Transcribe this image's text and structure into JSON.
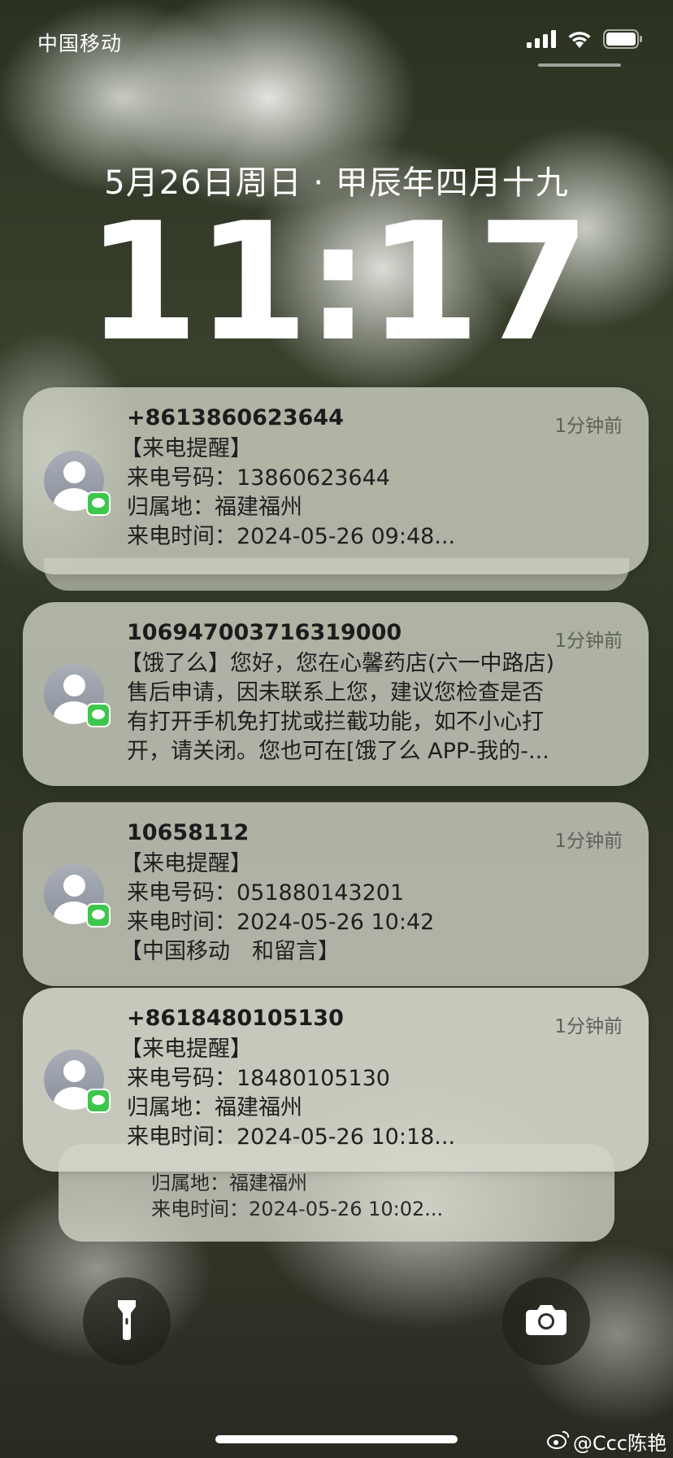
{
  "status_bar": {
    "carrier": "中国移动",
    "icons": [
      "cellular-signal-icon",
      "wifi-icon",
      "battery-icon"
    ]
  },
  "lock_screen": {
    "date": "5月26日周日 · 甲辰年四月十九",
    "time": "11:17"
  },
  "notifications": [
    {
      "sender": "+8613860623644",
      "time_ago": "1分钟前",
      "lines": [
        "【来电提醒】",
        "来电号码：13860623644",
        "归属地：福建福州",
        "来电时间：2024-05-26 09:48..."
      ]
    },
    {
      "sender": "10694700371631900​0",
      "time_ago": "1分钟前",
      "lines": [
        "【饿了么】您好，您在心馨药店(六一中路店)",
        "售后申请，因未联系上您，建议您检查是否",
        "有打开手机免打扰或拦截功能，如不小心打",
        "开，请关闭。您也可在[饿了么 APP-我的-..."
      ]
    },
    {
      "sender": "10658112",
      "time_ago": "1分钟前",
      "lines": [
        "【来电提醒】",
        "来电号码：051880143201",
        "来电时间：2024-05-26 10:42",
        "【中国移动　和留言】"
      ]
    },
    {
      "sender": "+8618480105130",
      "time_ago": "1分钟前",
      "lines": [
        "【来电提醒】",
        "来电号码：18480105130",
        "归属地：福建福州",
        "来电时间：2024-05-26 10:18..."
      ]
    }
  ],
  "stacked_notification": {
    "lines": [
      "归属地：福建福州",
      "来电时间：2024-05-26 10:02..."
    ]
  },
  "controls": {
    "flashlight": "flashlight-icon",
    "camera": "camera-icon"
  },
  "watermark": {
    "text": "@Ccc陈艳",
    "icon": "weibo-icon"
  }
}
